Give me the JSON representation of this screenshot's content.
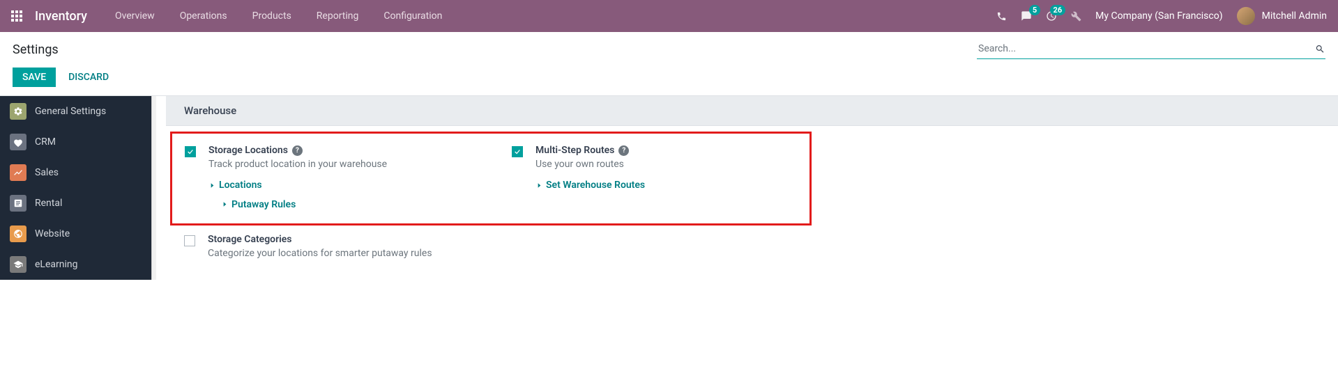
{
  "navbar": {
    "brand": "Inventory",
    "menu": [
      "Overview",
      "Operations",
      "Products",
      "Reporting",
      "Configuration"
    ],
    "msg_count": "5",
    "activity_count": "26",
    "company": "My Company (San Francisco)",
    "user": "Mitchell Admin"
  },
  "control": {
    "title": "Settings",
    "search_placeholder": "Search...",
    "save": "SAVE",
    "discard": "DISCARD"
  },
  "sidebar": {
    "items": [
      "General Settings",
      "CRM",
      "Sales",
      "Rental",
      "Website",
      "eLearning"
    ]
  },
  "section": {
    "title": "Warehouse"
  },
  "storage_locations": {
    "title": "Storage Locations",
    "desc": "Track product location in your warehouse",
    "link1": "Locations",
    "link2": "Putaway Rules"
  },
  "multi_step": {
    "title": "Multi-Step Routes",
    "desc": "Use your own routes",
    "link1": "Set Warehouse Routes"
  },
  "storage_categories": {
    "title": "Storage Categories",
    "desc": "Categorize your locations for smarter putaway rules"
  }
}
